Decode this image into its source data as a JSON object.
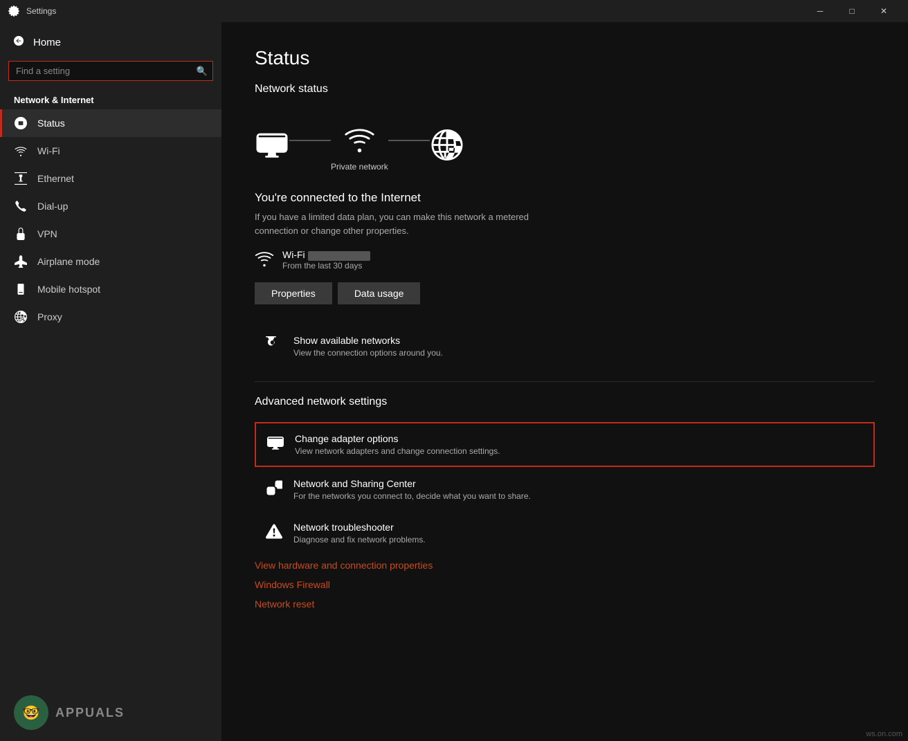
{
  "titlebar": {
    "title": "Settings",
    "minimize": "─",
    "maximize": "□",
    "close": "✕"
  },
  "sidebar": {
    "home_label": "Home",
    "search_placeholder": "Find a setting",
    "section_title": "Network & Internet",
    "items": [
      {
        "id": "status",
        "label": "Status",
        "active": true
      },
      {
        "id": "wifi",
        "label": "Wi-Fi",
        "active": false
      },
      {
        "id": "ethernet",
        "label": "Ethernet",
        "active": false
      },
      {
        "id": "dialup",
        "label": "Dial-up",
        "active": false
      },
      {
        "id": "vpn",
        "label": "VPN",
        "active": false
      },
      {
        "id": "airplane",
        "label": "Airplane mode",
        "active": false
      },
      {
        "id": "hotspot",
        "label": "Mobile hotspot",
        "active": false
      },
      {
        "id": "proxy",
        "label": "Proxy",
        "active": false
      }
    ]
  },
  "content": {
    "page_title": "Status",
    "network_status_title": "Network status",
    "network_label": "Private network",
    "connected_text": "You're connected to the Internet",
    "connected_desc": "If you have a limited data plan, you can make this network a metered connection or change other properties.",
    "wifi_name": "Wi-Fi",
    "wifi_days": "From the last 30 days",
    "properties_btn": "Properties",
    "data_usage_btn": "Data usage",
    "show_networks_title": "Show available networks",
    "show_networks_desc": "View the connection options around you.",
    "advanced_title": "Advanced network settings",
    "settings_items": [
      {
        "id": "adapter",
        "title": "Change adapter options",
        "desc": "View network adapters and change connection settings.",
        "highlighted": true
      },
      {
        "id": "sharing",
        "title": "Network and Sharing Center",
        "desc": "For the networks you connect to, decide what you want to share."
      },
      {
        "id": "troubleshoot",
        "title": "Network troubleshooter",
        "desc": "Diagnose and fix network problems."
      }
    ],
    "links": [
      "View hardware and connection properties",
      "Windows Firewall",
      "Network reset"
    ]
  },
  "watermark": "ws.on.com"
}
